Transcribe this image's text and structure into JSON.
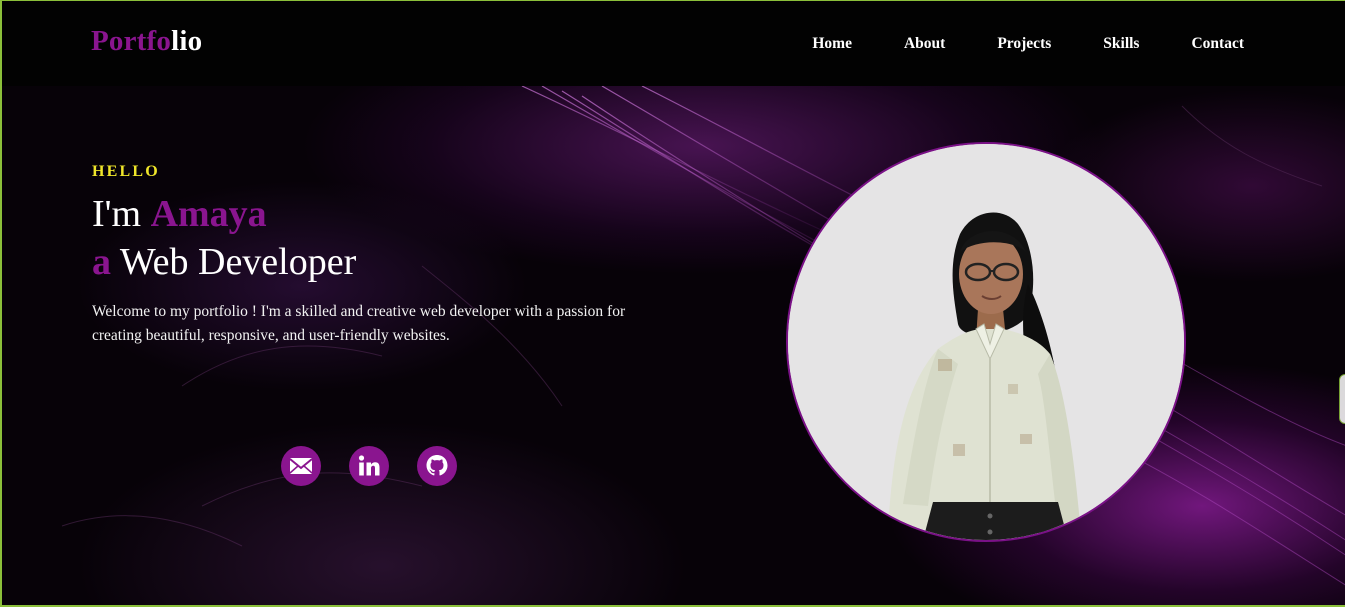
{
  "header": {
    "logo_accent": "Portfo",
    "logo_rest": "lio",
    "nav": [
      "Home",
      "About",
      "Projects",
      "Skills",
      "Contact"
    ]
  },
  "hero": {
    "greeting": "HELLO",
    "line1_prefix": "I'm ",
    "name": "Amaya",
    "line2_article": "a",
    "line2_role": " Web Developer",
    "intro": "Welcome to my portfolio ! I'm a skilled and creative web developer with a passion for creating beautiful, responsive, and user-friendly websites."
  },
  "socials": [
    {
      "icon": "mail-icon"
    },
    {
      "icon": "linkedin-icon"
    },
    {
      "icon": "github-icon"
    }
  ],
  "colors": {
    "accent": "#8a158f",
    "greeting": "#f0e62a",
    "background": "#000000"
  }
}
